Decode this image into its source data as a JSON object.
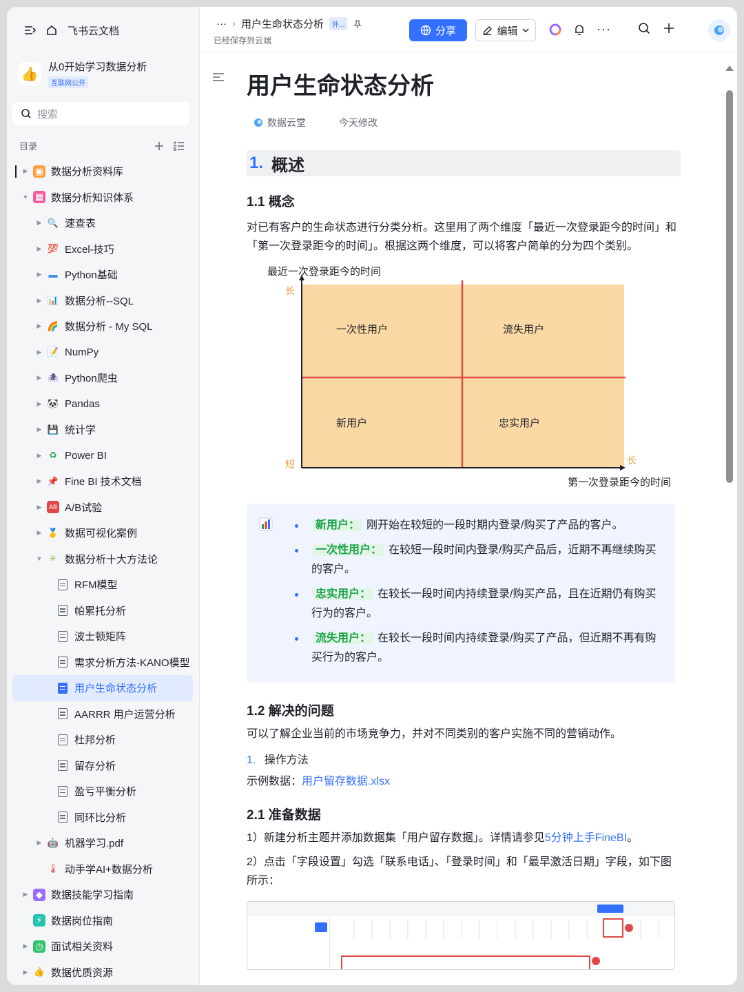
{
  "sidebar": {
    "app_name": "飞书云文档",
    "kb_title": "从0开始学习数据分析",
    "kb_badge": "互联网公开",
    "search_placeholder": "搜索",
    "toc_label": "目录",
    "items": [
      {
        "label": "数据分析资料库",
        "level": 0,
        "icon": "chart-book-icon"
      },
      {
        "label": "数据分析知识体系",
        "level": 0,
        "icon": "grid-icon",
        "expanded": true
      },
      {
        "label": "速查表",
        "level": 1,
        "icon": "magnifier-icon"
      },
      {
        "label": "Excel-技巧",
        "level": 1,
        "icon": "hundred-icon"
      },
      {
        "label": "Python基础",
        "level": 1,
        "icon": "monitor-icon"
      },
      {
        "label": "数据分析--SQL",
        "level": 1,
        "icon": "bar-chart-icon"
      },
      {
        "label": "数据分析 - My SQL",
        "level": 1,
        "icon": "rainbow-icon"
      },
      {
        "label": "NumPy",
        "level": 1,
        "icon": "pencil-note-icon"
      },
      {
        "label": "Python爬虫",
        "level": 1,
        "icon": "spider-icon"
      },
      {
        "label": "Pandas",
        "level": 1,
        "icon": "panda-icon"
      },
      {
        "label": "统计学",
        "level": 1,
        "icon": "floppy-icon"
      },
      {
        "label": "Power BI",
        "level": 1,
        "icon": "recycle-icon"
      },
      {
        "label": "Fine BI 技术文档",
        "level": 1,
        "icon": "pin-icon"
      },
      {
        "label": "A/B试验",
        "level": 1,
        "icon": "ab-icon"
      },
      {
        "label": "数据可视化案例",
        "level": 1,
        "icon": "medal-icon"
      },
      {
        "label": "数据分析十大方法论",
        "level": 1,
        "icon": "sparkle-icon",
        "expanded": true
      },
      {
        "label": "RFM模型",
        "level": 2,
        "icon": "doc-icon"
      },
      {
        "label": "帕累托分析",
        "level": 2,
        "icon": "doc-icon"
      },
      {
        "label": "波士顿矩阵",
        "level": 2,
        "icon": "doc-icon"
      },
      {
        "label": "需求分析方法-KANO模型",
        "level": 2,
        "icon": "doc-icon"
      },
      {
        "label": "用户生命状态分析",
        "level": 2,
        "icon": "doc-icon",
        "active": true
      },
      {
        "label": "AARRR 用户运营分析",
        "level": 2,
        "icon": "doc-icon"
      },
      {
        "label": "杜邦分析",
        "level": 2,
        "icon": "doc-icon"
      },
      {
        "label": "留存分析",
        "level": 2,
        "icon": "doc-icon"
      },
      {
        "label": "盈亏平衡分析",
        "level": 2,
        "icon": "doc-icon"
      },
      {
        "label": "同环比分析",
        "level": 2,
        "icon": "doc-icon"
      },
      {
        "label": "机器学习.pdf",
        "level": 1,
        "icon": "robot-icon"
      },
      {
        "label": "动手学AI+数据分析",
        "level": 1,
        "icon": "thermometer-icon",
        "no_caret": true
      },
      {
        "label": "数据技能学习指南",
        "level": 0,
        "icon": "purple-box-icon"
      },
      {
        "label": "数据岗位指南",
        "level": 0,
        "icon": "teal-bolt-icon",
        "no_caret": true
      },
      {
        "label": "面试相关资料",
        "level": 0,
        "icon": "green-clock-icon"
      },
      {
        "label": "数据优质资源",
        "level": 0,
        "icon": "thumb-icon"
      }
    ]
  },
  "header": {
    "breadcrumb_current": "用户生命状态分析",
    "breadcrumb_tag": "外...",
    "saved_status": "已经保存到云端",
    "share_label": "分享",
    "edit_label": "编辑"
  },
  "doc": {
    "title": "用户生命状态分析",
    "author": "数据云堂",
    "modified": "今天修改",
    "h1_num": "1.",
    "h1_text": "概述",
    "h2_1": "1.1 概念",
    "p1": "对已有客户的生命状态进行分类分析。这里用了两个维度「最近一次登录距今的时间」和「第一次登录距今的时间」。根据这两个维度，可以将客户简单的分为四个类别。",
    "quad": {
      "y_axis_label": "最近一次登录距今的时间",
      "x_axis_label": "第一次登录距今的时间",
      "y_long": "长",
      "y_short": "短",
      "x_long": "长",
      "q_top_left": "一次性用户",
      "q_top_right": "流失用户",
      "q_bottom_left": "新用户",
      "q_bottom_right": "忠实用户",
      "fill_color": "#fbd9a4",
      "line_color": "#e04848"
    },
    "bullets": [
      {
        "term": "新用户：",
        "text": "刚开始在较短的一段时期内登录/购买了产品的客户。"
      },
      {
        "term": "一次性用户：",
        "text": "在较短一段时间内登录/购买产品后，近期不再继续购买的客户。"
      },
      {
        "term": "忠实用户：",
        "text": "在较长一段时间内持续登录/购买产品，且在近期仍有购买行为的客户。"
      },
      {
        "term": "流失用户：",
        "text": "在较长一段时间内持续登录/购买了产品，但近期不再有购买行为的客户。"
      }
    ],
    "h2_2": "1.2 解决的问题",
    "p2": "可以了解企业当前的市场竞争力，并对不同类别的客户实施不同的营销动作。",
    "ol_num": "1.",
    "ol_text": "操作方法",
    "example_prefix": "示例数据：",
    "example_link": "用户留存数据.xlsx",
    "h2_3": "2.1 准备数据",
    "step1_prefix": "1）新建分析主题并添加数据集「用户留存数据」。详情请参见",
    "step1_link": "5分钟上手FineBI",
    "step1_suffix": "。",
    "step2": "2）点击「字段设置」勾选「联系电话」、「登录时间」和「最早激活日期」字段，如下图所示："
  },
  "colors": {
    "accent": "#3370ff",
    "highlight_green": "#1ba34a",
    "callout_bg": "#f0f4ff"
  }
}
